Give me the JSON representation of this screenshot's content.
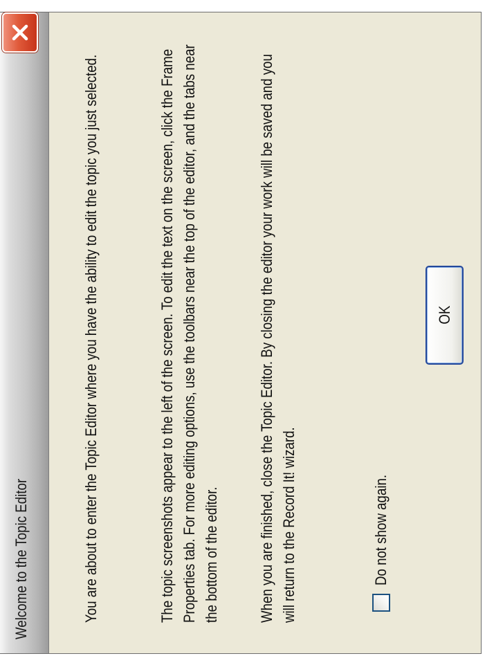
{
  "window": {
    "title": "Welcome to the Topic Editor"
  },
  "message": {
    "paragraph_1": "You are about to enter the Topic Editor where you have the ability to edit the topic you just selected.",
    "paragraph_2": "The topic screenshots appear to the left of the screen. To edit the text on the screen, click the Frame Properties tab. For more editing options, use the toolbars near the top of the editor, and the tabs near the bottom of the editor.",
    "paragraph_3": "When you are finished, close the Topic Editor. By closing the editor your work will be saved and you will return to the Record It! wizard."
  },
  "buttons": {
    "ok_label": "OK"
  },
  "checkbox": {
    "label": "Do not show again.",
    "checked": false
  },
  "icons": {
    "close": "close-icon"
  },
  "colors": {
    "dialog_background": "#ece9d8",
    "close_button": "#e05a3a",
    "ok_border": "#24489a"
  }
}
